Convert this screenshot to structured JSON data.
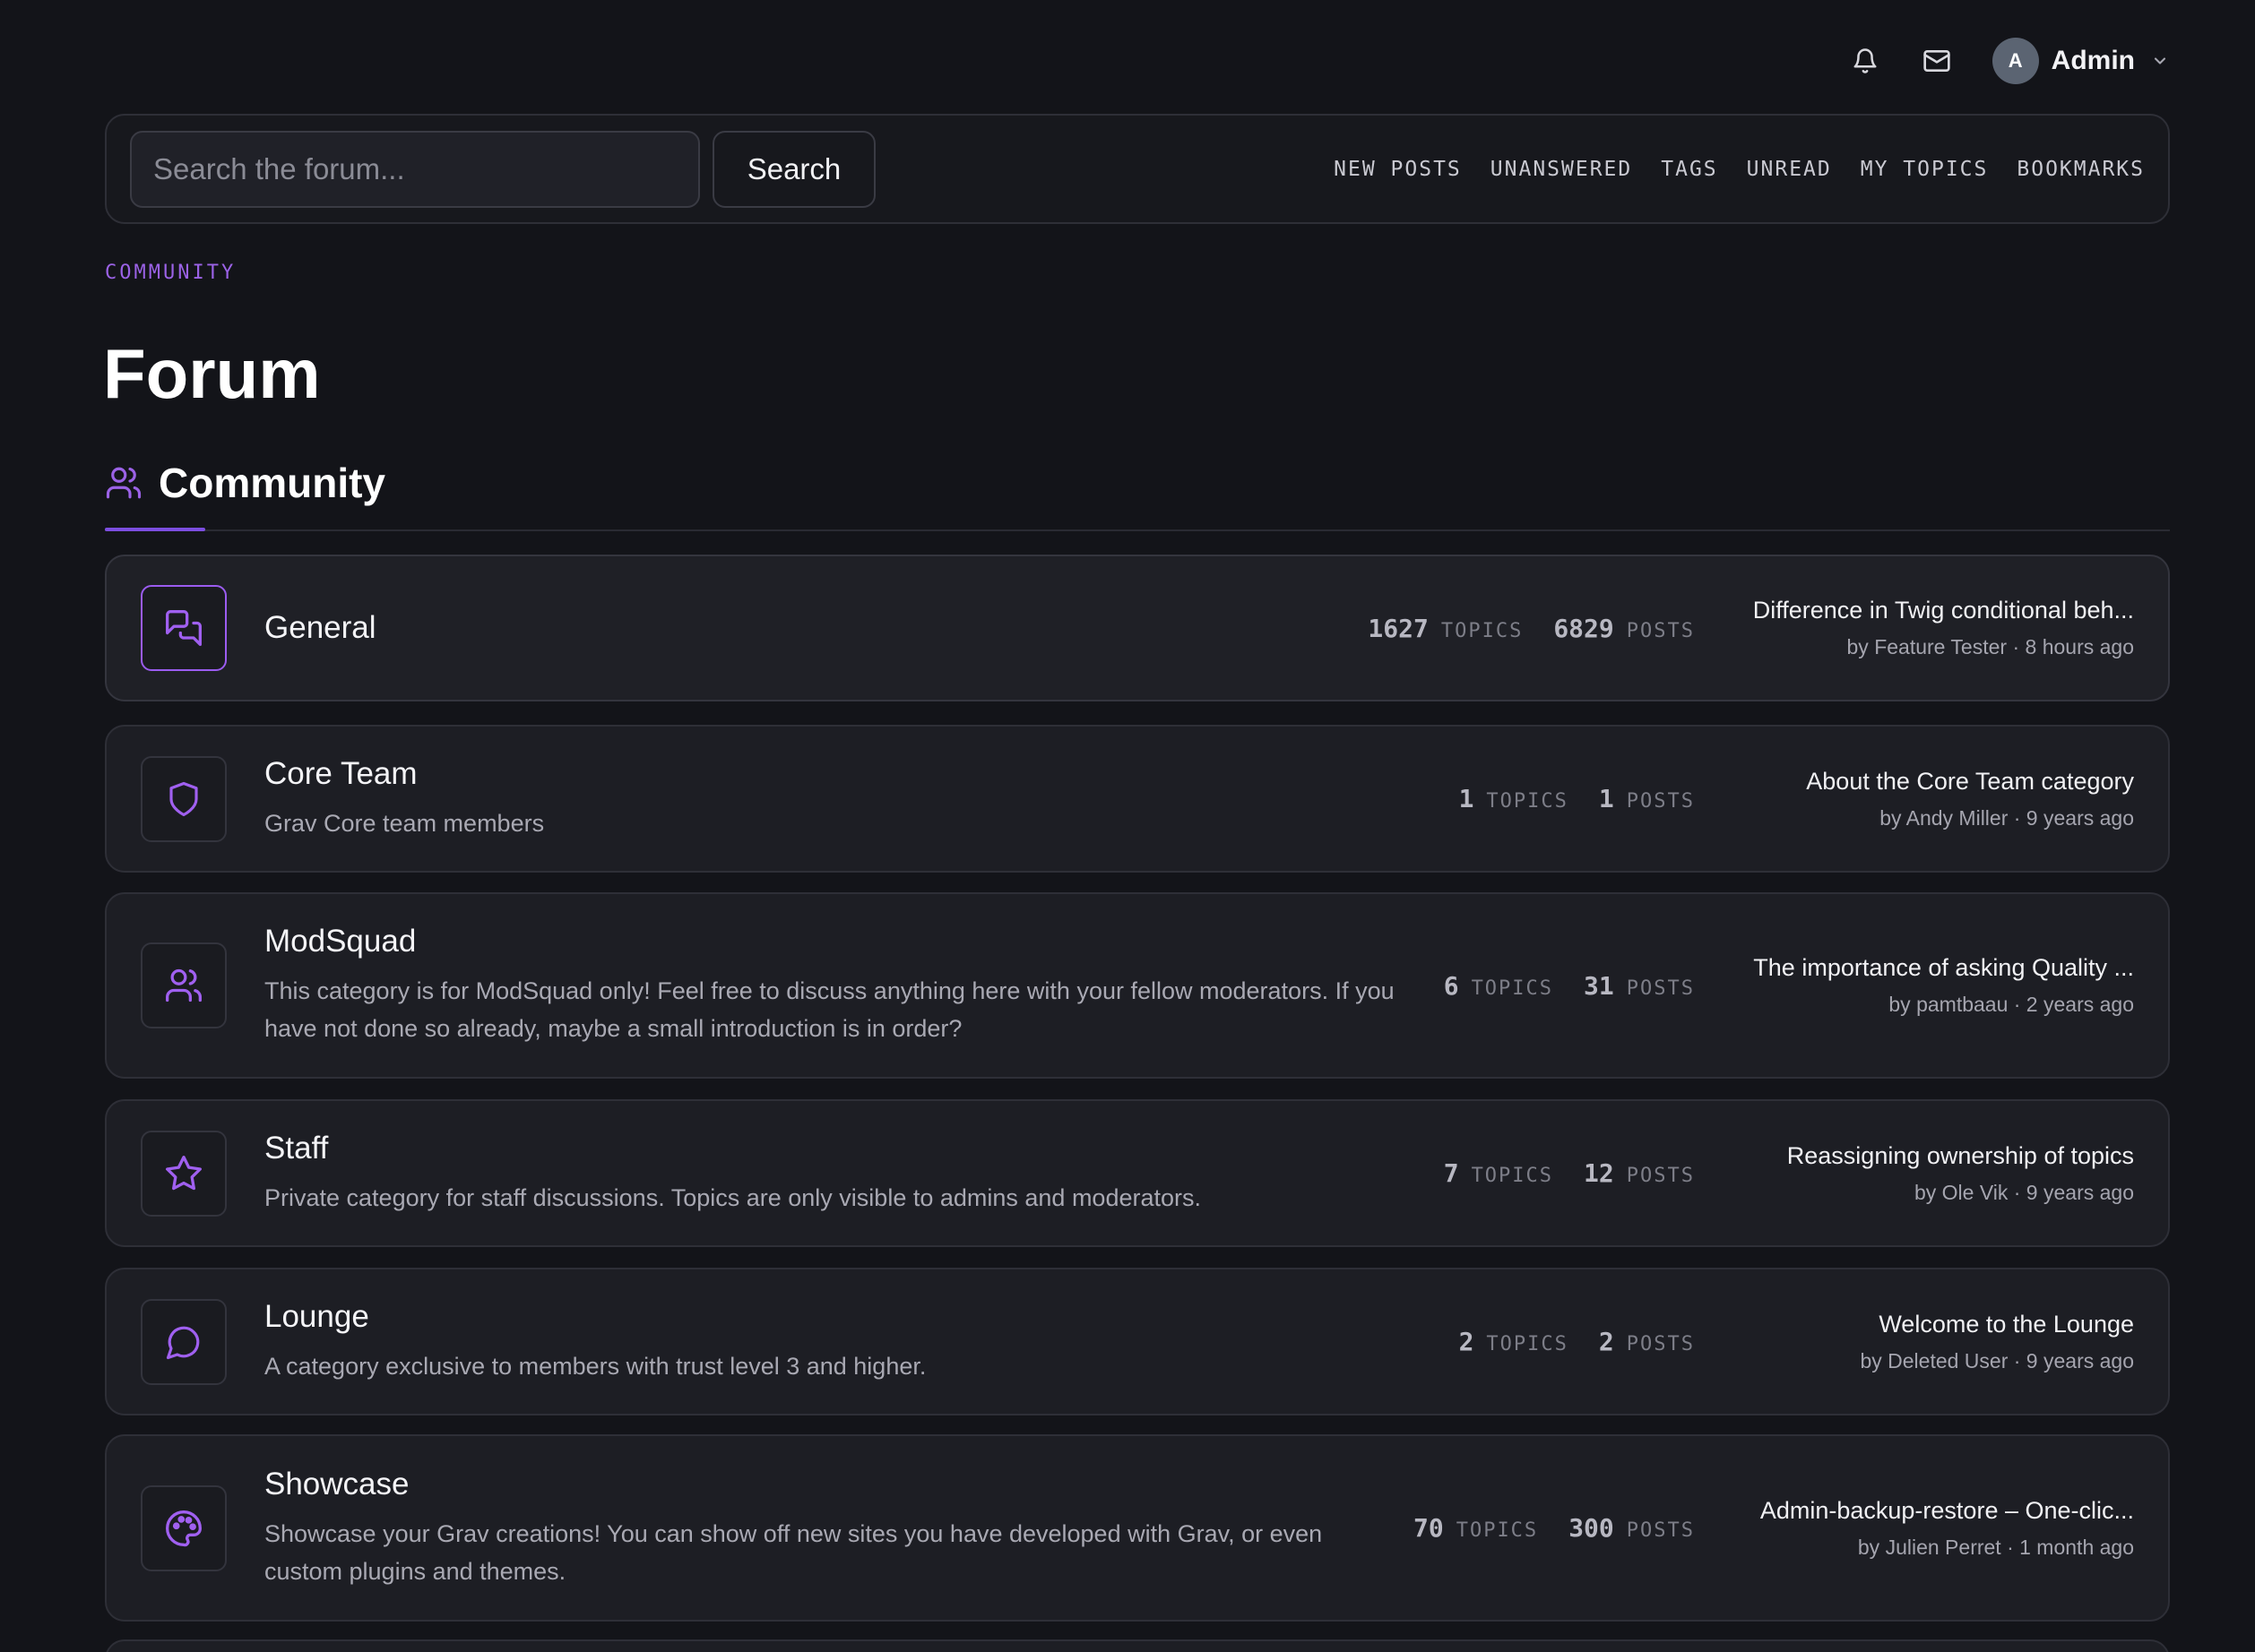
{
  "header": {
    "notifications_icon": "bell-icon",
    "messages_icon": "mail-icon",
    "user": {
      "initial": "A",
      "name": "Admin"
    }
  },
  "search": {
    "placeholder": "Search the forum...",
    "button_label": "Search"
  },
  "nav": {
    "links": [
      "NEW POSTS",
      "UNANSWERED",
      "TAGS",
      "UNREAD",
      "MY TOPICS",
      "BOOKMARKS"
    ]
  },
  "page": {
    "eyebrow": "COMMUNITY",
    "title": "Forum"
  },
  "section": {
    "title": "Community",
    "icon": "users-icon",
    "accent_color": "#7c4ee0"
  },
  "categories": [
    {
      "name": "General",
      "description": "",
      "icon": "chat-bubbles-icon",
      "topics": "1627",
      "topics_label": "TOPICS",
      "posts": "6829",
      "posts_label": "POSTS",
      "latest_title": "Difference in Twig conditional beh...",
      "latest_meta": "by Feature Tester · 8 hours ago"
    },
    {
      "name": "Core Team",
      "description": "Grav Core team members",
      "icon": "shield-icon",
      "topics": "1",
      "topics_label": "TOPICS",
      "posts": "1",
      "posts_label": "POSTS",
      "latest_title": "About the Core Team category",
      "latest_meta": "by Andy Miller · 9 years ago"
    },
    {
      "name": "ModSquad",
      "description": "This category is for ModSquad only! Feel free to discuss anything here with your fellow moderators. If you have not done so already, maybe a small introduction is in order?",
      "icon": "users-icon",
      "topics": "6",
      "topics_label": "TOPICS",
      "posts": "31",
      "posts_label": "POSTS",
      "latest_title": "The importance of asking Quality ...",
      "latest_meta": "by pamtbaau · 2 years ago"
    },
    {
      "name": "Staff",
      "description": "Private category for staff discussions. Topics are only visible to admins and moderators.",
      "icon": "star-icon",
      "topics": "7",
      "topics_label": "TOPICS",
      "posts": "12",
      "posts_label": "POSTS",
      "latest_title": "Reassigning ownership of topics",
      "latest_meta": "by Ole Vik · 9 years ago"
    },
    {
      "name": "Lounge",
      "description": "A category exclusive to members with trust level 3 and higher.",
      "icon": "speech-bubble-icon",
      "topics": "2",
      "topics_label": "TOPICS",
      "posts": "2",
      "posts_label": "POSTS",
      "latest_title": "Welcome to the Lounge",
      "latest_meta": "by Deleted User · 9 years ago"
    },
    {
      "name": "Showcase",
      "description": "Showcase your Grav creations! You can show off new sites you have developed with Grav, or even custom plugins and themes.",
      "icon": "palette-icon",
      "topics": "70",
      "topics_label": "TOPICS",
      "posts": "300",
      "posts_label": "POSTS",
      "latest_title": "Admin-backup-restore – One-clic...",
      "latest_meta": "by Julien Perret · 1 month ago"
    }
  ]
}
